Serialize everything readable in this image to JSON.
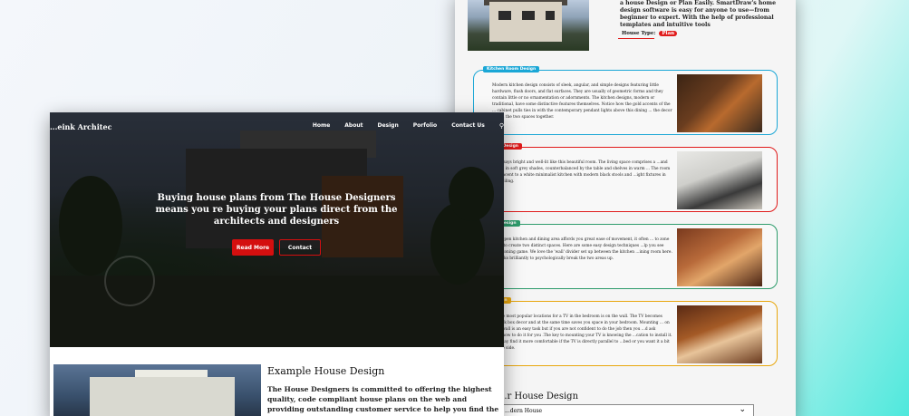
{
  "back_page": {
    "intro_text": "Guarantees we stand by to ensure this happens.Make a house Design or Plan Easily. SmartDraw's home design software is easy for anyone to use—from beginner to expert. With the help of professional templates and intuitive tools",
    "house_type_label": "House Type:",
    "house_type_value": "Plan",
    "cards": [
      {
        "tag": "Kitchen Room Design",
        "text": "Modern kitchen design consists of sleek, angular, and simple designs featuring little hardware, flush doors, and flat surfaces. They are usually of geometric forms and they contain little or no ornamentation or adornments. The kitchen designs, modern or traditional, have some distinctive features themselves. Notice how the gold accents of the ... cabinet pulls ties in with the contemporary pendant lights above this dining ... the decor unites the two spaces together."
      },
      {
        "tag": "...oom Design",
        "text": "...ing says bright and well-lit like this beautiful room. The living space comprises a ...and chairs in soft grey shades, counterbalanced by the table and shelves in warm ... The room is adjacent to a white minimalist kitchen with modern black stools and ...ight fixtures in the ceiling."
      },
      {
        "tag": "...oor Design",
        "text": "...an open kitchen and dining area affords you great ease of movement, it often ... to zone them to create two distinct spaces. Here are some easy design techniques ...lp you see your zoning game. We love the 'wall' divider set up between the kitchen ...ining room here. It works brilliantly to psychologically break the two areas up."
      },
      {
        "tag": "...Design",
        "text": "...f the most popular locations for a TV in the bedroom is on the wall. The TV becomes ...black box decor and at the same time saves you space in your bedroom. Mounting ... on your wall is an easy task but if you are not confident to do the job then you ...d ask somehow to do it for you .The key to mounting your TV is knowing the ...cation to install it. You may find it more comfortable if the TV is directly parallel to ...bed or you want it a bit on the side."
      }
    ],
    "find_house_title": "...r House Design",
    "select_value": "...dern House"
  },
  "front_page": {
    "brand": "...eink Architec",
    "nav": [
      "Home",
      "About",
      "Design",
      "Porfolio",
      "Contact Us"
    ],
    "headline": "Buying house plans from The House Designers means you re buying your plans direct from the architects and designers",
    "read_more": "Read More",
    "contact": "Contact",
    "example_title": "Example House Design",
    "example_text": "The House Designers is committed to offering the highest quality, code compliant house plans on the web and providing outstanding customer service to help you find the perfect home"
  },
  "colors": {
    "accent_red": "#d40f0f",
    "card_blue": "#1ba7d6",
    "card_red": "#e01b1b",
    "card_green": "#2e9c6c",
    "card_yellow": "#e8a70e"
  },
  "icons": {
    "search": "search-icon",
    "chevron": "chevron-down-icon"
  }
}
